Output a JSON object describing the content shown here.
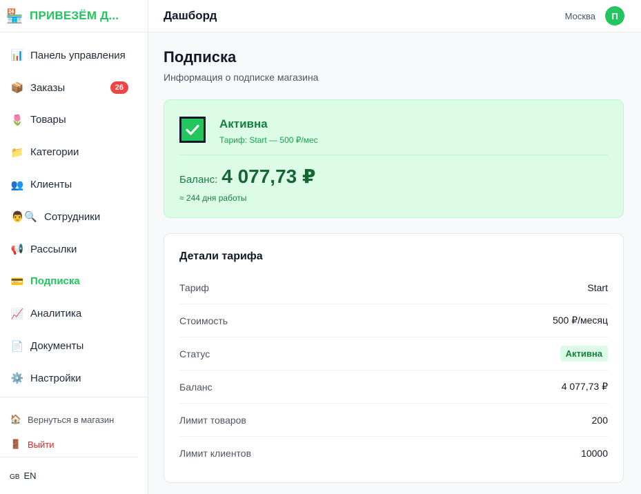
{
  "brand": {
    "name": "ПРИВЕЗЁМ Д...",
    "logo_icon": "🏪"
  },
  "sidebar": {
    "items": [
      {
        "label": "Панель управления",
        "icon": "📊",
        "name": "dashboard"
      },
      {
        "label": "Заказы",
        "icon": "📦",
        "name": "orders",
        "badge": "26"
      },
      {
        "label": "Товары",
        "icon": "🌷",
        "name": "products"
      },
      {
        "label": "Категории",
        "icon": "📁",
        "name": "categories"
      },
      {
        "label": "Клиенты",
        "icon": "👥",
        "name": "clients"
      },
      {
        "label": "Сотрудники",
        "icon": "👨🔍",
        "name": "employees"
      },
      {
        "label": "Рассылки",
        "icon": "📢",
        "name": "mailings"
      },
      {
        "label": "Подписка",
        "icon": "💳",
        "name": "subscription",
        "active": true
      },
      {
        "label": "Аналитика",
        "icon": "📈",
        "name": "analytics"
      },
      {
        "label": "Документы",
        "icon": "📄",
        "name": "documents"
      },
      {
        "label": "Настройки",
        "icon": "⚙️",
        "name": "settings"
      }
    ],
    "back_to_store": {
      "label": "Вернуться в магазин",
      "icon": "🏠"
    },
    "logout": {
      "label": "Выйти",
      "icon": "🚪"
    },
    "language": {
      "flag": "GB",
      "label": "EN"
    }
  },
  "topbar": {
    "title": "Дашборд",
    "city": "Москва",
    "avatar_letter": "П"
  },
  "page": {
    "title": "Подписка",
    "subtitle": "Информация о подписке магазина"
  },
  "status_card": {
    "title": "Активна",
    "plan": "Тариф: Start — 500 ₽/мес",
    "balance_label": "Баланс:",
    "balance_value": "4 077,73 ₽",
    "days": "≈ 244 дня работы"
  },
  "details": {
    "title": "Детали тарифа",
    "rows": [
      {
        "label": "Тариф",
        "value": "Start"
      },
      {
        "label": "Стоимость",
        "value": "500 ₽/месяц"
      },
      {
        "label": "Статус",
        "value": "Активна"
      },
      {
        "label": "Баланс",
        "value": "4 077,73 ₽"
      },
      {
        "label": "Лимит товаров",
        "value": "200"
      },
      {
        "label": "Лимит клиентов",
        "value": "10000"
      }
    ]
  }
}
